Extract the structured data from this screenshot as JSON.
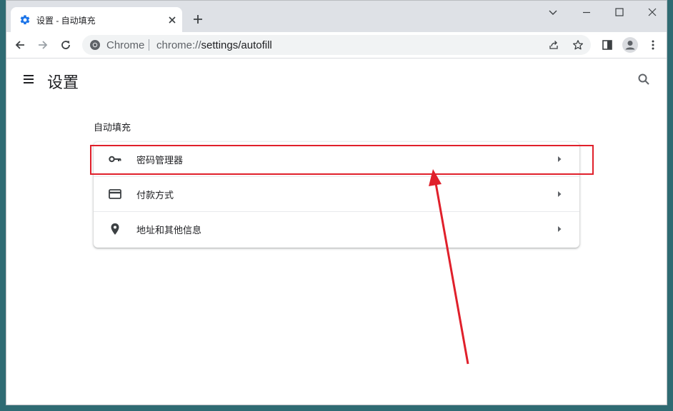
{
  "tab": {
    "title": "设置 - 自动填充",
    "favicon": "gear-icon",
    "close_icon": "close-icon"
  },
  "newtab": {
    "icon": "plus-icon"
  },
  "window_controls": [
    "chevron-down-icon",
    "minimize-icon",
    "maximize-icon",
    "close-icon"
  ],
  "toolbar": {
    "back_icon": "arrow-left-icon",
    "forward_icon": "arrow-right-icon",
    "reload_icon": "reload-icon",
    "origin_label": "Chrome",
    "url_prefix": "chrome://",
    "url_path": "settings/autofill",
    "share_icon": "share-icon",
    "bookmark_icon": "star-icon",
    "sidepanel_icon": "side-panel-icon",
    "profile_icon": "avatar-icon",
    "menu_icon": "kebab-menu-icon"
  },
  "header": {
    "title": "设置",
    "menu_icon": "hamburger-icon",
    "search_icon": "search-icon"
  },
  "section": {
    "title": "自动填充"
  },
  "rows": [
    {
      "label": "密码管理器",
      "icon": "key-icon"
    },
    {
      "label": "付款方式",
      "icon": "credit-card-icon"
    },
    {
      "label": "地址和其他信息",
      "icon": "location-pin-icon"
    }
  ],
  "colors": {
    "accent": "#1a73e8",
    "annotation": "#e0202b",
    "tabstrip": "#dee1e6"
  }
}
